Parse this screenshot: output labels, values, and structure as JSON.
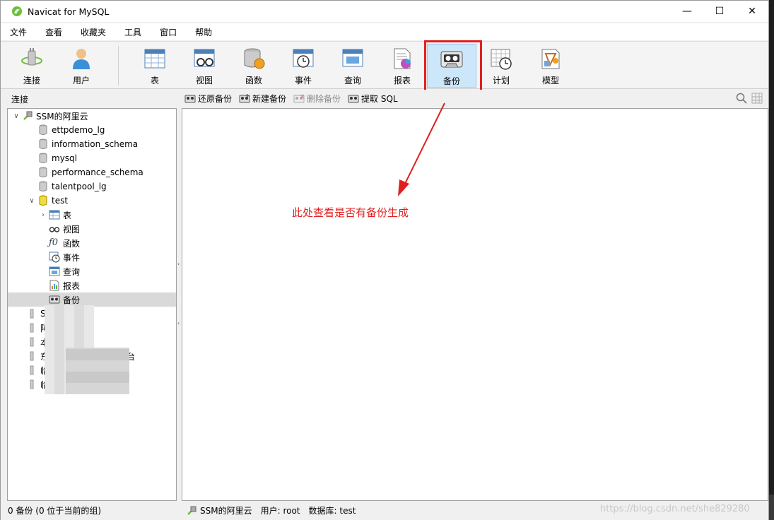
{
  "window": {
    "title": "Navicat for MySQL",
    "controls": {
      "minimize": "—",
      "maximize": "☐",
      "close": "✕"
    }
  },
  "menu": [
    "文件",
    "查看",
    "收藏夹",
    "工具",
    "窗口",
    "帮助"
  ],
  "toolbar": {
    "connect": "连接",
    "user": "用户",
    "table": "表",
    "view": "视图",
    "function": "函数",
    "event": "事件",
    "query": "查询",
    "report": "报表",
    "backup": "备份",
    "schedule": "计划",
    "model": "模型"
  },
  "subbar": {
    "connection_label": "连接",
    "actions": [
      {
        "label": "还原备份",
        "enabled": true
      },
      {
        "label": "新建备份",
        "enabled": true
      },
      {
        "label": "删除备份",
        "enabled": false
      },
      {
        "label": "提取 SQL",
        "enabled": true
      }
    ]
  },
  "tree": {
    "connection": "SSM的阿里云",
    "databases": [
      "ettpdemo_lg",
      "information_schema",
      "mysql",
      "performance_schema",
      "talentpool_lg"
    ],
    "open_db": "test",
    "objects": [
      "表",
      "视图",
      "函数",
      "事件",
      "查询",
      "报表",
      "备份"
    ],
    "selected_object": "备份",
    "other_connections": [
      "SS",
      "阿",
      "本",
      "东",
      "台",
      "临",
      "临"
    ]
  },
  "annotation": {
    "text": "此处查看是否有备份生成",
    "color": "#e02020"
  },
  "status": {
    "left": "0 备份 (0 位于当前的组)",
    "connection": "SSM的阿里云",
    "user": "用户: root",
    "database": "数据库: test",
    "watermark": "https://blog.csdn.net/she829280"
  },
  "colors": {
    "accent_selected": "#cce6fa",
    "highlight_red": "#e02020"
  }
}
